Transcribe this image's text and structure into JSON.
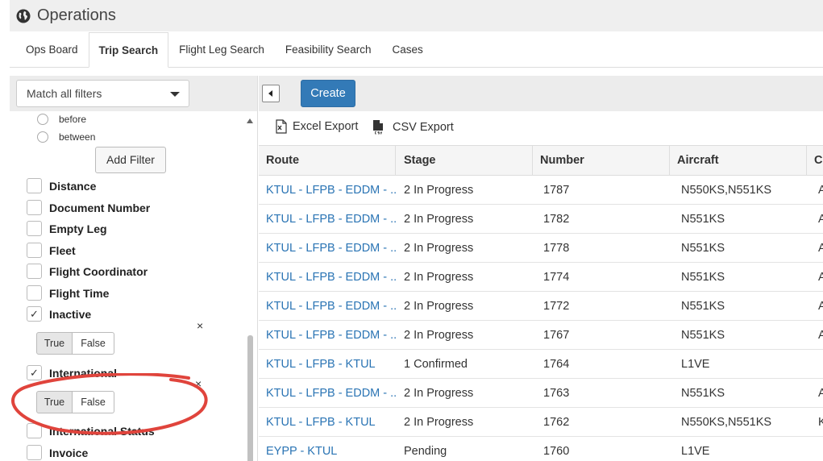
{
  "window": {
    "title": "Operations",
    "icon": "globe-icon"
  },
  "tabs": [
    {
      "label": "Ops Board",
      "active": false
    },
    {
      "label": "Trip Search",
      "active": true
    },
    {
      "label": "Flight Leg Search",
      "active": false
    },
    {
      "label": "Feasibility Search",
      "active": false
    },
    {
      "label": "Cases",
      "active": false
    }
  ],
  "filters": {
    "match_select": "Match all filters",
    "radio_options": [
      "before",
      "between"
    ],
    "add_filter_label": "Add Filter",
    "items": [
      {
        "label": "Distance",
        "checked": false
      },
      {
        "label": "Document Number",
        "checked": false
      },
      {
        "label": "Empty Leg",
        "checked": false
      },
      {
        "label": "Fleet",
        "checked": false
      },
      {
        "label": "Flight Coordinator",
        "checked": false
      },
      {
        "label": "Flight Time",
        "checked": false
      },
      {
        "label": "Inactive",
        "checked": true
      },
      {
        "label": "International",
        "checked": true
      },
      {
        "label": "International Status",
        "checked": false
      },
      {
        "label": "Invoice",
        "checked": false
      }
    ],
    "true_label": "True",
    "false_label": "False",
    "close_glyph": "×",
    "checkmark": "✓"
  },
  "toolbar": {
    "create_label": "Create"
  },
  "exports": {
    "excel_label": "Excel Export",
    "csv_label": "CSV Export"
  },
  "grid": {
    "columns": [
      "Route",
      "Stage",
      "Number",
      "Aircraft",
      "Cr"
    ],
    "rows": [
      {
        "route": "KTUL - LFPB - EDDM - ...",
        "stage": "2 In Progress",
        "number": "1787",
        "aircraft": "N550KS,N551KS",
        "extra": "A"
      },
      {
        "route": "KTUL - LFPB - EDDM - ...",
        "stage": "2 In Progress",
        "number": "1782",
        "aircraft": "N551KS",
        "extra": "A"
      },
      {
        "route": "KTUL - LFPB - EDDM - ...",
        "stage": "2 In Progress",
        "number": "1778",
        "aircraft": "N551KS",
        "extra": "A"
      },
      {
        "route": "KTUL - LFPB - EDDM - ...",
        "stage": "2 In Progress",
        "number": "1774",
        "aircraft": "N551KS",
        "extra": "A"
      },
      {
        "route": "KTUL - LFPB - EDDM - ...",
        "stage": "2 In Progress",
        "number": "1772",
        "aircraft": "N551KS",
        "extra": "A"
      },
      {
        "route": "KTUL - LFPB - EDDM - ...",
        "stage": "2 In Progress",
        "number": "1767",
        "aircraft": "N551KS",
        "extra": "A"
      },
      {
        "route": "KTUL - LFPB - KTUL",
        "stage": "1 Confirmed",
        "number": "1764",
        "aircraft": "L1VE",
        "extra": ""
      },
      {
        "route": "KTUL - LFPB - EDDM - ...",
        "stage": "2 In Progress",
        "number": "1763",
        "aircraft": "N551KS",
        "extra": "A"
      },
      {
        "route": "KTUL - LFPB - KTUL",
        "stage": "2 In Progress",
        "number": "1762",
        "aircraft": "N550KS,N551KS",
        "extra": "K"
      },
      {
        "route": "EYPP - KTUL",
        "stage": "Pending",
        "number": "1760",
        "aircraft": "L1VE",
        "extra": ""
      }
    ]
  },
  "colors": {
    "link": "#2a74b4",
    "primary": "#337ab7",
    "annotation": "#e0443c"
  }
}
